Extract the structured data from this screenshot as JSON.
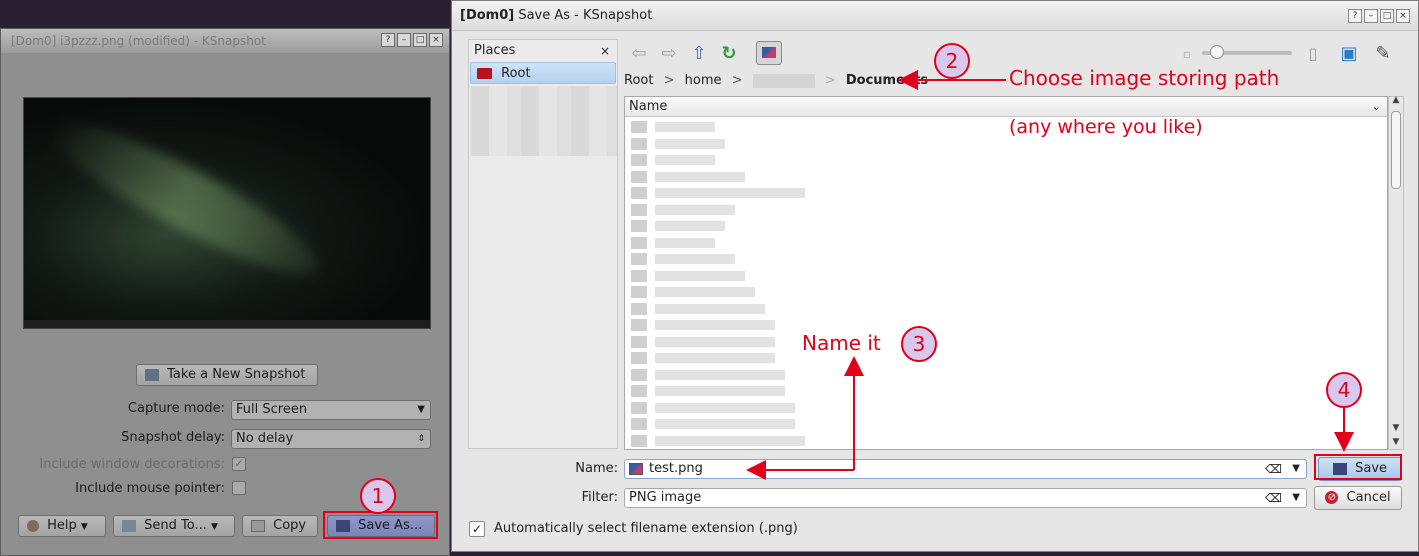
{
  "background_window": {
    "title": "[Dom0] i3pzzz.png (modified) - KSnapshot",
    "new_snapshot_label": "Take a New Snapshot",
    "capture_mode_label": "Capture mode:",
    "capture_mode_value": "Full Screen",
    "snapshot_delay_label": "Snapshot delay:",
    "snapshot_delay_value": "No delay",
    "include_decorations_label": "Include window decorations:",
    "include_pointer_label": "Include mouse pointer:",
    "help_label": "Help",
    "send_to_label": "Send To...",
    "copy_label": "Copy",
    "save_as_label": "Save As..."
  },
  "dialog": {
    "title_bold": "[Dom0]",
    "title": "Save As - KSnapshot",
    "places": {
      "header": "Places",
      "close_glyph": "×",
      "items": [
        {
          "label": "Root"
        }
      ]
    },
    "breadcrumb": {
      "items": [
        "Root",
        "home"
      ],
      "separator": ">",
      "current": "Documents"
    },
    "file_list": {
      "column_header": "Name"
    },
    "name_label": "Name:",
    "name_value": "test.png",
    "filter_label": "Filter:",
    "filter_value": "PNG image",
    "save_label": "Save",
    "cancel_label": "Cancel",
    "auto_extension_label": "Automatically select filename extension (.png)",
    "auto_extension_checked": true
  },
  "annotations": {
    "step1": "1",
    "step2": "2",
    "step2_text": "Choose image storing path",
    "step2_subtext": "(any where you like)",
    "step3": "3",
    "step3_text": "Name it",
    "step4": "4",
    "color": "#e0001b"
  },
  "icons": {
    "back": "back-arrow-icon",
    "forward": "forward-arrow-icon",
    "up": "up-arrow-icon",
    "reload": "reload-icon",
    "preview": "preview-icon",
    "new_folder": "new-folder-icon",
    "options": "wrench-icon"
  }
}
